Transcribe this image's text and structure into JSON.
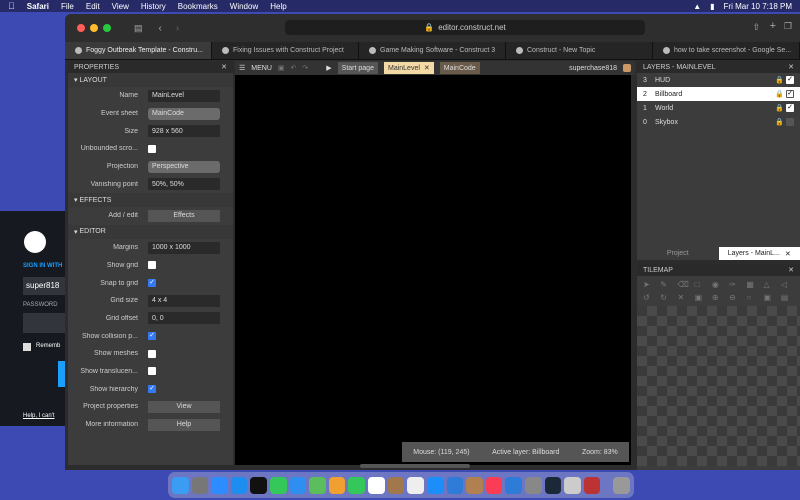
{
  "menubar": {
    "items": [
      "Safari",
      "File",
      "Edit",
      "View",
      "History",
      "Bookmarks",
      "Window",
      "Help"
    ],
    "datetime": "Fri Mar 10  7:18 PM"
  },
  "browser": {
    "url": "editor.construct.net",
    "tabs": [
      "Foggy Outbreak Template - Constru...",
      "Fixing Issues with Construct Project",
      "Game Making Software - Construct 3",
      "Construct - New Topic",
      "how to take screenshot - Google Se..."
    ]
  },
  "properties": {
    "title": "PROPERTIES",
    "sections": {
      "layout": "LAYOUT",
      "effects": "EFFECTS",
      "editor": "EDITOR"
    },
    "layout_props": [
      {
        "label": "Name",
        "value": "MainLevel"
      },
      {
        "label": "Event sheet",
        "value": "MainCode"
      },
      {
        "label": "Size",
        "value": "928 x 560"
      },
      {
        "label": "Unbounded scro...",
        "value": ""
      },
      {
        "label": "Projection",
        "value": "Perspective"
      },
      {
        "label": "Vanishing point",
        "value": "50%, 50%"
      }
    ],
    "effects_props": [
      {
        "label": "Add / edit",
        "value": "Effects"
      }
    ],
    "editor_props": [
      {
        "label": "Margins",
        "value": "1000 x 1000"
      },
      {
        "label": "Show grid",
        "value": ""
      },
      {
        "label": "Snap to grid",
        "value": ""
      },
      {
        "label": "Grid size",
        "value": "4 x 4"
      },
      {
        "label": "Grid offset",
        "value": "0, 0"
      },
      {
        "label": "Show collision p...",
        "value": ""
      },
      {
        "label": "Show meshes",
        "value": ""
      },
      {
        "label": "Show translucen...",
        "value": ""
      },
      {
        "label": "Show hierarchy",
        "value": ""
      },
      {
        "label": "Project properties",
        "value": "View"
      },
      {
        "label": "More information",
        "value": "Help"
      }
    ]
  },
  "toolbar": {
    "menu_label": "MENU",
    "tabs": [
      "Start page",
      "MainLevel",
      "MainCode"
    ],
    "user": "superchase818"
  },
  "status": {
    "mouse": "Mouse: (119, 245)",
    "layer": "Active layer: Billboard",
    "zoom": "Zoom: 83%"
  },
  "layers": {
    "title": "LAYERS - MAINLEVEL",
    "items": [
      {
        "num": "3",
        "name": "HUD"
      },
      {
        "num": "2",
        "name": "Billboard"
      },
      {
        "num": "1",
        "name": "World"
      },
      {
        "num": "0",
        "name": "Skybox"
      }
    ],
    "tabs": [
      "Project",
      "Layers - MainL..."
    ]
  },
  "tilemap": {
    "title": "TILEMAP"
  },
  "steam": {
    "sign_in": "SIGN IN WITH",
    "account": "super818",
    "password_label": "PASSWORD",
    "remember": "Rememb",
    "help": "Help, I can't"
  }
}
